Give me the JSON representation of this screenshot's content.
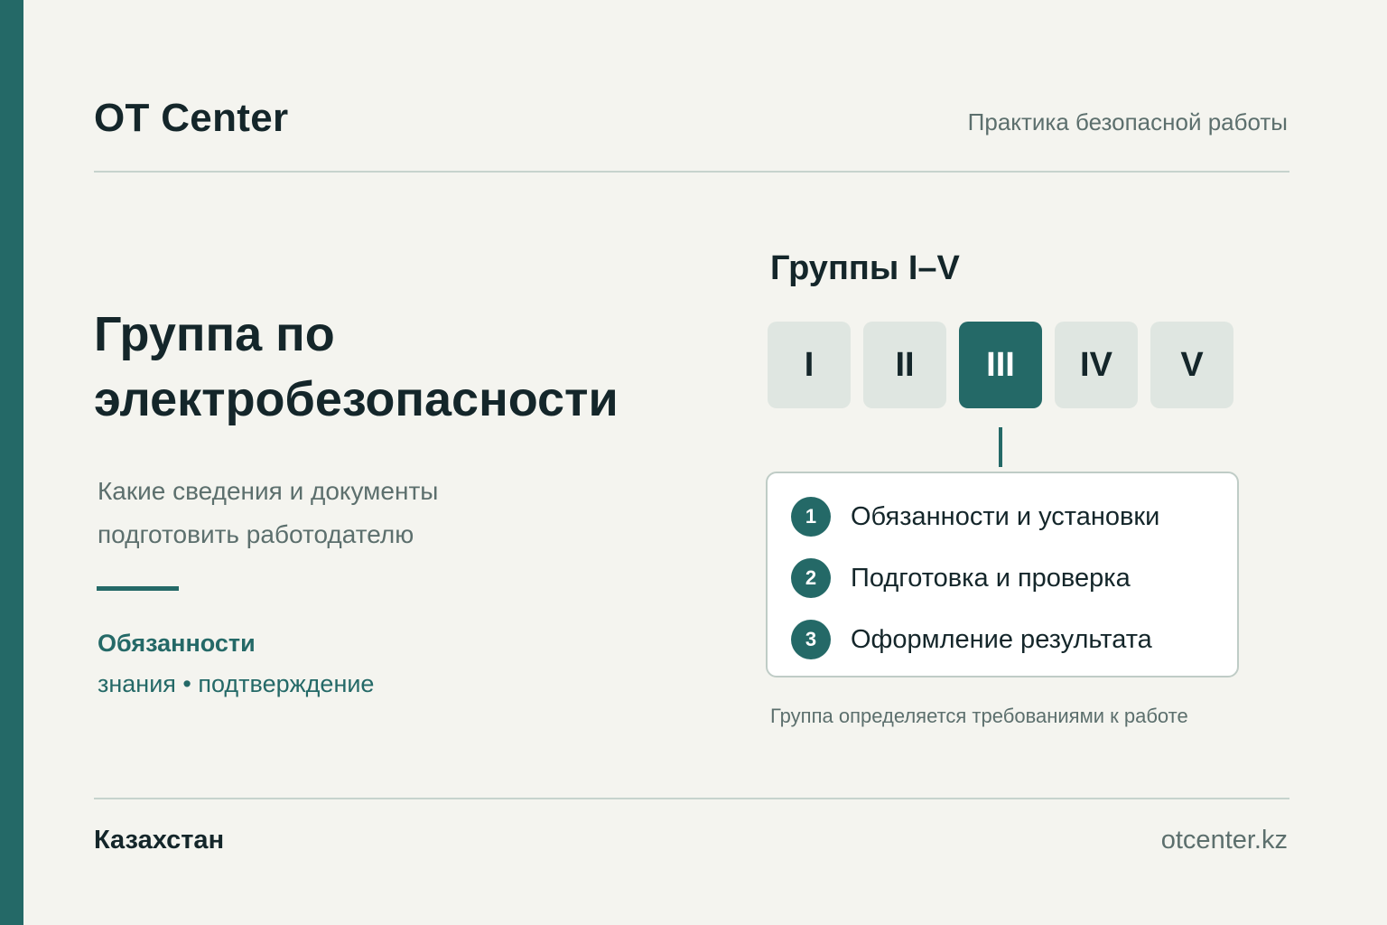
{
  "header": {
    "brand": "OT Center",
    "tagline": "Практика безопасной работы"
  },
  "main": {
    "title_lines": [
      "Группа по",
      "электробезопасности"
    ],
    "subtitle_lines": [
      "Какие сведения и документы",
      "подготовить работодателю"
    ],
    "duties_title": "Обязанности",
    "duties_sub": "знания • подтверждение"
  },
  "groups": {
    "title": "Группы I–V",
    "items": [
      {
        "label": "I",
        "active": false
      },
      {
        "label": "II",
        "active": false
      },
      {
        "label": "III",
        "active": true
      },
      {
        "label": "IV",
        "active": false
      },
      {
        "label": "V",
        "active": false
      }
    ],
    "steps": [
      {
        "num": "1",
        "label": "Обязанности и установки"
      },
      {
        "num": "2",
        "label": "Подготовка и проверка"
      },
      {
        "num": "3",
        "label": "Оформление результата"
      }
    ],
    "note": "Группа определяется требованиями к работе"
  },
  "footer": {
    "left": "Казахстан",
    "right": "otcenter.kz"
  },
  "colors": {
    "accent": "#246967",
    "background": "#f4f4ef",
    "text": "#14262a",
    "muted": "#5c6f6d",
    "tile": "#dfe6e1"
  }
}
